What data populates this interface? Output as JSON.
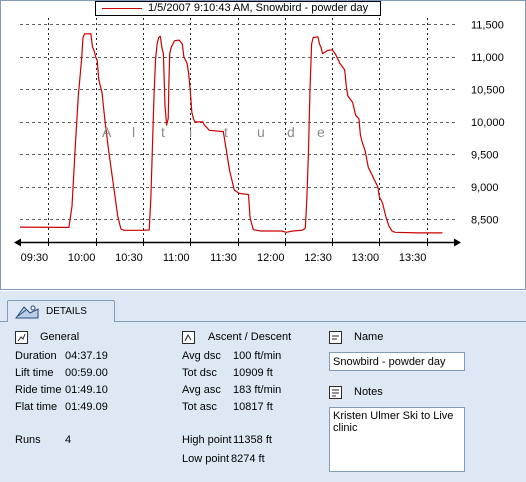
{
  "chart": {
    "legend_label": "1/5/2007 9:10:43 AM, Snowbird - powder day",
    "watermark": [
      "A",
      "l",
      "t",
      "i",
      "t",
      "u",
      "d",
      "e"
    ],
    "series_color": "#cc0000"
  },
  "chart_data": {
    "type": "line",
    "title": "",
    "ylabel": "Altitude",
    "xlabel": "",
    "x_tick_labels": [
      "09:30",
      "10:00",
      "10:30",
      "11:00",
      "11:30",
      "12:00",
      "12:30",
      "13:00",
      "13:30"
    ],
    "x_ticks_min": [
      570,
      600,
      630,
      660,
      690,
      720,
      750,
      780,
      810
    ],
    "y_tick_labels": [
      "8,500",
      "9,000",
      "9,500",
      "10,000",
      "10,500",
      "11,000",
      "11,500"
    ],
    "y_ticks": [
      8500,
      9000,
      9500,
      10000,
      10500,
      11000,
      11500
    ],
    "ylim": [
      8150,
      11600
    ],
    "xlim_min": [
      552,
      828
    ],
    "grid": true,
    "legend_position": "top",
    "series": [
      {
        "name": "1/5/2007 9:10:43 AM, Snowbird - powder day",
        "points_min": [
          [
            552,
            8380
          ],
          [
            576,
            8375
          ],
          [
            583,
            8375
          ],
          [
            585,
            8700
          ],
          [
            587,
            9600
          ],
          [
            589,
            10400
          ],
          [
            591,
            10950
          ],
          [
            592,
            11300
          ],
          [
            593,
            11355
          ],
          [
            597,
            11358
          ],
          [
            598,
            11150
          ],
          [
            599,
            11100
          ],
          [
            600,
            11000
          ],
          [
            601,
            10950
          ],
          [
            602,
            10650
          ],
          [
            604,
            10450
          ],
          [
            606,
            10000
          ],
          [
            608,
            9600
          ],
          [
            610,
            9250
          ],
          [
            612,
            8900
          ],
          [
            614,
            8550
          ],
          [
            616,
            8350
          ],
          [
            618,
            8330
          ],
          [
            630,
            8330
          ],
          [
            634,
            8335
          ],
          [
            635,
            8800
          ],
          [
            636,
            9600
          ],
          [
            637,
            10400
          ],
          [
            638,
            10950
          ],
          [
            639,
            11200
          ],
          [
            640,
            11300
          ],
          [
            641,
            11320
          ],
          [
            642,
            11150
          ],
          [
            643,
            11050
          ],
          [
            644,
            10250
          ],
          [
            645,
            9950
          ],
          [
            646,
            10050
          ],
          [
            646.5,
            10600
          ],
          [
            647,
            11050
          ],
          [
            648,
            11150
          ],
          [
            649,
            11200
          ],
          [
            650,
            11250
          ],
          [
            653,
            11260
          ],
          [
            655,
            11200
          ],
          [
            656,
            11000
          ],
          [
            658,
            10900
          ],
          [
            659,
            10750
          ],
          [
            660,
            10500
          ],
          [
            661,
            10150
          ],
          [
            662,
            10050
          ],
          [
            663,
            10000
          ],
          [
            668,
            10000
          ],
          [
            669,
            9950
          ],
          [
            671,
            9900
          ],
          [
            672,
            9870
          ],
          [
            681,
            9850
          ],
          [
            683,
            9550
          ],
          [
            685,
            9250
          ],
          [
            688,
            8950
          ],
          [
            691,
            8900
          ],
          [
            697,
            8880
          ],
          [
            698,
            8520
          ],
          [
            700,
            8340
          ],
          [
            705,
            8320
          ],
          [
            718,
            8320
          ],
          [
            721,
            8300
          ],
          [
            725,
            8320
          ],
          [
            731,
            8330
          ],
          [
            733,
            8360
          ],
          [
            734,
            8800
          ],
          [
            735,
            9500
          ],
          [
            736,
            10500
          ],
          [
            737,
            11200
          ],
          [
            738,
            11300
          ],
          [
            741,
            11310
          ],
          [
            742,
            11200
          ],
          [
            743,
            11150
          ],
          [
            744,
            11050
          ],
          [
            747,
            11100
          ],
          [
            750,
            11110
          ],
          [
            752,
            11050
          ],
          [
            754,
            10950
          ],
          [
            755,
            10900
          ],
          [
            758,
            10800
          ],
          [
            759,
            10550
          ],
          [
            760,
            10400
          ],
          [
            763,
            10300
          ],
          [
            765,
            10100
          ],
          [
            767,
            10050
          ],
          [
            768,
            9800
          ],
          [
            769,
            9700
          ],
          [
            771,
            9550
          ],
          [
            773,
            9300
          ],
          [
            775,
            9200
          ],
          [
            777,
            9100
          ],
          [
            779,
            9000
          ],
          [
            780,
            8850
          ],
          [
            782,
            8750
          ],
          [
            784,
            8550
          ],
          [
            786,
            8400
          ],
          [
            788,
            8320
          ],
          [
            790,
            8300
          ],
          [
            805,
            8290
          ],
          [
            820,
            8290
          ]
        ]
      }
    ]
  },
  "details": {
    "tab_label": "DETAILS",
    "general": {
      "title": "General",
      "rows": [
        {
          "label": "Duration",
          "value": "04:37.19"
        },
        {
          "label": "Lift time",
          "value": "00:59.00"
        },
        {
          "label": "Ride time",
          "value": "01:49.10"
        },
        {
          "label": "Flat time",
          "value": "01:49.09"
        }
      ],
      "runs_label": "Runs",
      "runs_value": "4"
    },
    "ascent": {
      "title": "Ascent / Descent",
      "rows": [
        {
          "label": "Avg dsc",
          "value": "100 ft/min"
        },
        {
          "label": "Tot dsc",
          "value": "10909 ft"
        },
        {
          "label": "Avg asc",
          "value": "183 ft/min"
        },
        {
          "label": "Tot asc",
          "value": "10817 ft"
        }
      ],
      "high_label": "High point",
      "high_value": "11358 ft",
      "low_label": "Low point",
      "low_value": "8274 ft"
    },
    "name": {
      "title": "Name",
      "value": "Snowbird - powder day"
    },
    "notes": {
      "title": "Notes",
      "value": "Kristen Ulmer Ski to Live clinic"
    }
  }
}
